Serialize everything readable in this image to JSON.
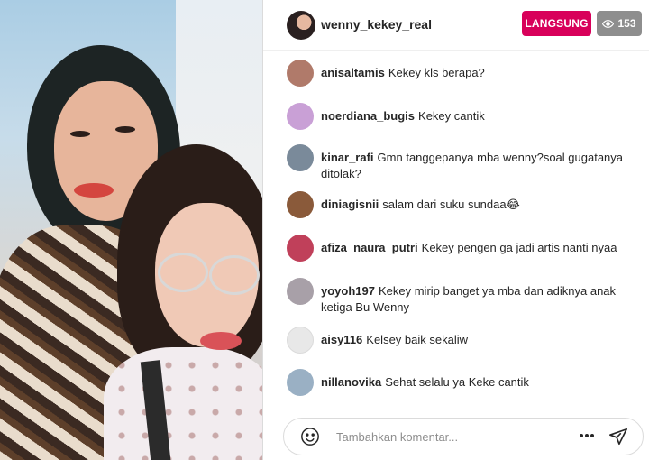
{
  "stream": {
    "username": "wenny_kekey_real",
    "live_label": "LANGSUNG",
    "viewer_count": "153",
    "icons": {
      "viewers": "eye-icon"
    }
  },
  "comments": [
    {
      "user": "anisaltamis",
      "text": "Kekey kls berapa?",
      "avatar_color": "#b07a6a"
    },
    {
      "user": "noerdiana_bugis",
      "text": "Kekey cantik",
      "avatar_color": "#c9a0d6"
    },
    {
      "user": "kinar_rafi",
      "text": "Gmn tanggepanya mba wenny?soal gugatanya ditolak?",
      "avatar_color": "#7a8a9a"
    },
    {
      "user": "diniagisnii",
      "text": "salam dari suku sundaa😂",
      "avatar_color": "#8a5a3a"
    },
    {
      "user": "afiza_naura_putri",
      "text": "Kekey pengen ga jadi artis nanti nyaa",
      "avatar_color": "#c0405a"
    },
    {
      "user": "yoyoh197",
      "text": "Kekey mirip banget ya mba dan adiknya anak ketiga Bu Wenny",
      "avatar_color": "#a8a0a8"
    },
    {
      "user": "aisy116",
      "text": "Kelsey baik sekaliw",
      "avatar_color": "#e8e8e8"
    },
    {
      "user": "nillanovika",
      "text": "Sehat selalu ya Keke cantik",
      "avatar_color": "#9ab0c4"
    }
  ],
  "composer": {
    "placeholder": "Tambahkan komentar...",
    "icons": {
      "emoji": "smiley-icon",
      "more": "more-options-icon",
      "send": "send-icon"
    }
  }
}
